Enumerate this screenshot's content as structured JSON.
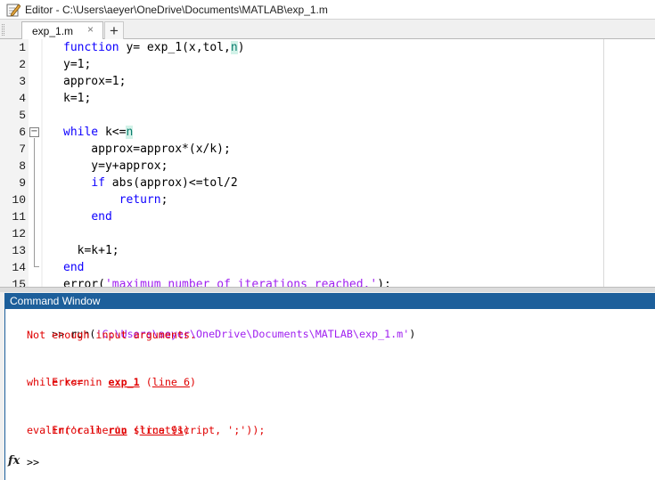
{
  "editor": {
    "title": "Editor - C:\\Users\\aeyer\\OneDrive\\Documents\\MATLAB\\exp_1.m",
    "tab_label": "exp_1.m",
    "tab_close": "×",
    "new_tab": "+",
    "fold_collapse": "−",
    "lines": [
      {
        "n": "1",
        "kw": "function",
        "a": " y= exp_1(x,tol,",
        "hl": "n",
        "b": ")"
      },
      {
        "n": "2",
        "a": "y=1;"
      },
      {
        "n": "3",
        "a": "approx=1;"
      },
      {
        "n": "4",
        "a": "k=1;"
      },
      {
        "n": "5",
        "a": ""
      },
      {
        "n": "6",
        "kw": "while",
        "a": " k<=",
        "hl": "n"
      },
      {
        "n": "7",
        "a": "    approx=approx*(x/k);"
      },
      {
        "n": "8",
        "a": "    y=y+approx;"
      },
      {
        "n": "9",
        "pre": "    ",
        "kw": "if",
        "a": " abs(approx)<=tol/2"
      },
      {
        "n": "10",
        "pre": "        ",
        "kw": "return",
        "a": ";"
      },
      {
        "n": "11",
        "pre": "    ",
        "kw": "end"
      },
      {
        "n": "12",
        "a": ""
      },
      {
        "n": "13",
        "a": "  k=k+1;"
      },
      {
        "n": "14",
        "kw": "end"
      },
      {
        "n": "15",
        "a": "error(",
        "str": "'maximum number of iterations reached.'",
        "b": ");"
      }
    ]
  },
  "command_window": {
    "title": "Command Window",
    "run_cmd": ">> run(",
    "run_path": "'C:\\Users\\aeyer\\OneDrive\\Documents\\MATLAB\\exp_1.m'",
    "run_close": ")",
    "err_msg": "Not enough input arguments.",
    "err1_prefix": "Error in ",
    "err1_func": "exp_1",
    "err1_sep": " (",
    "err1_line": "line 6",
    "err1_close": ")",
    "err1_code": "while k<=n",
    "err2_prefix": "Error in ",
    "err2_func": "run",
    "err2_sep": " (",
    "err2_line": "line 91",
    "err2_close": ")",
    "err2_code": "evalin('caller', strcat(script, ';'));",
    "fx": "fx",
    "prompt": ">>"
  },
  "colors": {
    "keyword": "#0e00ff",
    "string": "#a020f0",
    "error": "#e00000",
    "header": "#1d5f9b"
  }
}
